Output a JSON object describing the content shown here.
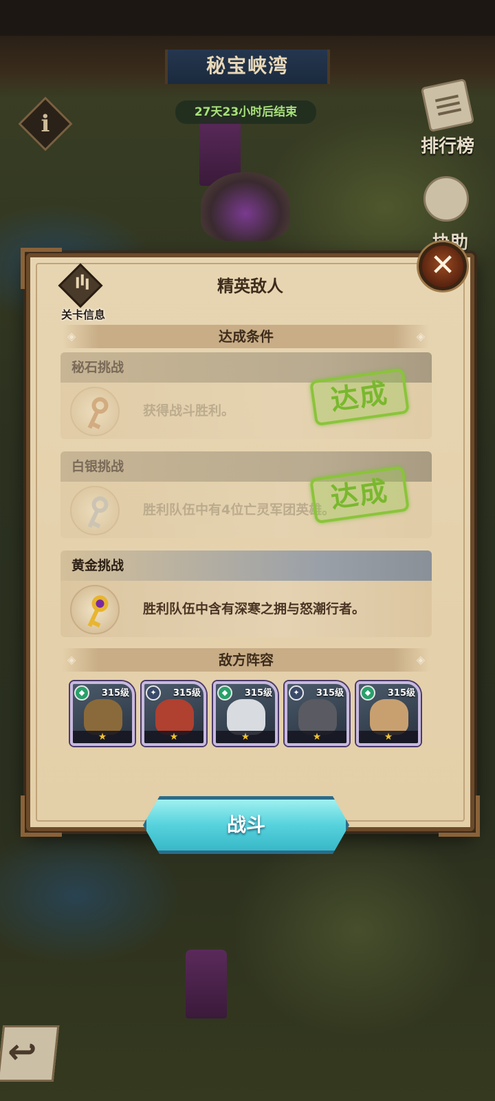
{
  "map": {
    "title": "秘宝峡湾",
    "timer": "27天23小时后结束",
    "rank_label": "排行榜",
    "assist_label": "协助",
    "info_glyph": "i",
    "back_glyph": "↩"
  },
  "dialog": {
    "title": "精英敌人",
    "stage_info_label": "关卡信息",
    "close_glyph": "✕",
    "conditions_header": "达成条件",
    "challenges": [
      {
        "name": "秘石挑战",
        "desc": "获得战斗胜利。",
        "key": "bronze-key-icon",
        "completed": true,
        "stamp": "达成"
      },
      {
        "name": "白银挑战",
        "desc": "胜利队伍中有4位亡灵军团英雄。",
        "key": "silver-key-icon",
        "completed": true,
        "stamp": "达成"
      },
      {
        "name": "黄金挑战",
        "desc": "胜利队伍中含有深寒之拥与怒潮行者。",
        "key": "gold-key-icon",
        "completed": false
      }
    ],
    "enemy_header": "敌方阵容",
    "heroes": [
      {
        "level": "315级",
        "stars": "★",
        "faction": "green"
      },
      {
        "level": "315级",
        "stars": "★",
        "faction": "silver"
      },
      {
        "level": "315级",
        "stars": "★",
        "faction": "green"
      },
      {
        "level": "315级",
        "stars": "★",
        "faction": "silver"
      },
      {
        "level": "315级",
        "stars": "★",
        "faction": "green"
      }
    ],
    "battle_button": "战斗"
  },
  "colors": {
    "stamp_green": "#79b82e",
    "battle_cyan": "#56d2dc",
    "parchment": "#e7d5b2",
    "frame_brown": "#6b4a2a"
  }
}
